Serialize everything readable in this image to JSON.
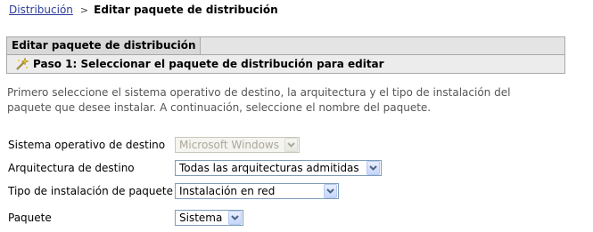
{
  "breadcrumb": {
    "parent": "Distribución",
    "separator": ">",
    "current": "Editar paquete de distribución"
  },
  "panel": {
    "title": "Editar paquete de distribución",
    "step": "Paso 1: Seleccionar el paquete de distribución para editar",
    "step_icon": "wand-edit-icon"
  },
  "intro": {
    "line1": "Primero seleccione el sistema operativo de destino, la arquitectura y el tipo de instalación del",
    "line2": "paquete que desee instalar. A continuación, seleccione el nombre del paquete."
  },
  "form": {
    "os": {
      "label": "Sistema operativo de destino",
      "value": "Microsoft Windows",
      "disabled": true
    },
    "arch": {
      "label": "Arquitectura de destino",
      "value": "Todas las arquitecturas admitidas"
    },
    "install_type": {
      "label": "Tipo de instalación de paquete",
      "value": "Instalación en red"
    },
    "package": {
      "label": "Paquete",
      "value": "Sistema"
    }
  },
  "colors": {
    "link": "#2c3b9b",
    "panel_header": "#d8d8d8",
    "select_border": "#7f9db9"
  }
}
